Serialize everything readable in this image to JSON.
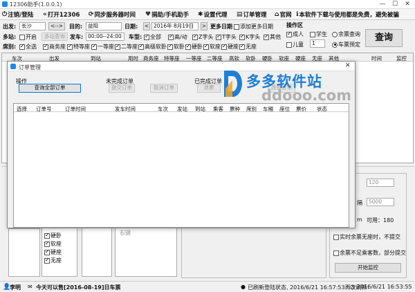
{
  "window": {
    "title": "12306助手(1.0.0.1)"
  },
  "menu": [
    {
      "icon": "power-icon",
      "glyph": "⏻",
      "label": "注销/登陆"
    },
    {
      "icon": "double-arrow-icon",
      "glyph": "«",
      "label": "打开12306"
    },
    {
      "icon": "sync-icon",
      "glyph": "⟳",
      "label": "同步服务器时间"
    },
    {
      "icon": "heart-icon",
      "glyph": "♥",
      "label": "捐助/手机助手"
    },
    {
      "icon": "gear-icon",
      "glyph": "✱",
      "label": "设置代理"
    },
    {
      "icon": "cart-icon",
      "glyph": "▤",
      "label": "订单管理"
    },
    {
      "icon": "home-icon",
      "glyph": "⌂",
      "label": "官网"
    },
    {
      "icon": "info-icon",
      "glyph": "ℹ",
      "label": "本软件下载与使用都是免费，避免被骗"
    }
  ],
  "search": {
    "from_label": "出发:",
    "from_value": "长沙",
    "swap_label": "<-->",
    "to_label": "目的:",
    "to_value": "益阳",
    "date_label": "日期:",
    "date_value": "2016年 8月19日",
    "more_dates_label": "更多日期",
    "add_more_dates_label": "添加更多日期",
    "station_label": "多站:",
    "open_label": "开启",
    "multi_station_btn": "多站查询",
    "depart_label": "发车:",
    "depart_value": "00:00--24:00",
    "train_type_label": "车型:",
    "train_types": [
      "全部",
      "高/动",
      "Z字头",
      "T字头",
      "K字头",
      "其他"
    ],
    "seat_label": "席别:",
    "seat_types": [
      "全选",
      "商务座",
      "特等座",
      "一等座",
      "二等座",
      "高级软卧",
      "软卧",
      "硬卧",
      "软座",
      "硬座",
      "无座"
    ]
  },
  "options": {
    "section_label": "操作区",
    "adult_label": "成人",
    "student_label": "学生",
    "child_label": "儿童",
    "child_count": "1",
    "remaining_query_label": "余票查询",
    "ticket_reserve_label": "车票预定",
    "query_button": "查询"
  },
  "train_grid": {
    "headers": [
      "车次",
      "出发",
      "到站",
      "用时",
      "商务座",
      "特等座",
      "一等座",
      "二等座",
      "高软",
      "软卧",
      "硬卧",
      "软座",
      "硬座",
      "无座",
      "其他",
      "时间",
      "监控"
    ]
  },
  "dialog": {
    "title": "订单管理",
    "ops_label": "操作",
    "query_all_button": "查询全部订单",
    "pending_label": "未完成订单",
    "pay_button": "提交订单",
    "cancel_button": "取消订单",
    "completed_label": "已完成订单",
    "refund_button": "退票",
    "change_button": "改签订单",
    "headers": [
      "选择",
      "订单号",
      "订单时间",
      "发车时间",
      "车次",
      "发站",
      "到站",
      "乘客",
      "票种",
      "席别",
      "车厢",
      "座位",
      "票价",
      "状态"
    ]
  },
  "lower": {
    "seat_checks": [
      "硬卧",
      "软座",
      "硬座",
      "无座"
    ],
    "hidden_box_text": "右键",
    "interval_value": "120",
    "interval2_value": "5000",
    "interval2_label": "隔",
    "available_label": "可用：180",
    "m_label": "m",
    "realtime_label": "实时余票无座时，不提交",
    "insufficient_label": "余票不足乘客数，部分提交",
    "start_monitor_button": "开始监控"
  },
  "status": {
    "user": "李明",
    "notice": "今天可以售[2016-08-19]日车票",
    "refresh_text": "已刷新登陆状态, 2016/6/21 16:57:53再次刷新!",
    "time_text": "2016/6/21 16:53:55"
  },
  "watermark": {
    "cn": "多多软件站",
    "en": "ddooo.com"
  },
  "colors": {
    "accent": "#1e88e5",
    "watermark_blue": "#1e7fd6",
    "watermark_gray": "#b0b0b0"
  }
}
